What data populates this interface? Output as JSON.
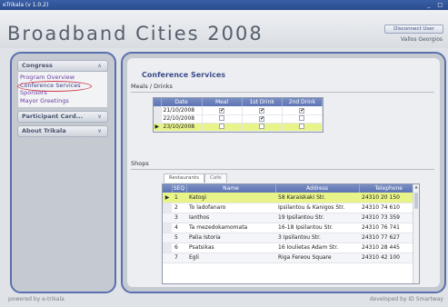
{
  "window": {
    "title": "eTrikala (v 1.0.2)",
    "controls": "_ □"
  },
  "header": {
    "brand": "Broadband Cities 2008",
    "disconnect_label": "Disconnect User",
    "username": "Vallos Georgios"
  },
  "sidebar": {
    "sections": [
      {
        "title": "Congress",
        "items": [
          "Program Overview",
          "Conference Services",
          "Sponsors",
          "Mayor Greetings"
        ]
      },
      {
        "title": "Participant Card..."
      },
      {
        "title": "About Trikala"
      }
    ]
  },
  "main": {
    "title": "Conference Services",
    "meals": {
      "group_label": "Meals / Drinks",
      "columns": [
        "Date",
        "Meal",
        "1st Drink",
        "2nd Drink"
      ],
      "rows": [
        {
          "date": "21/10/2008",
          "meal": true,
          "d1": true,
          "d2": true
        },
        {
          "date": "22/10/2008",
          "meal": false,
          "d1": true,
          "d2": false
        },
        {
          "date": "23/10/2008",
          "meal": false,
          "d1": false,
          "d2": false
        }
      ]
    },
    "shops": {
      "group_label": "Shops",
      "tabs": [
        "Restaurants",
        "Cafe"
      ],
      "columns": [
        "SEQ",
        "Name",
        "Address",
        "Telephone"
      ],
      "rows": [
        {
          "seq": "1",
          "name": "Katogi",
          "address": "58 Karaiskaki Str.",
          "phone": "24310 20 150"
        },
        {
          "seq": "2",
          "name": "To ladofanaro",
          "address": "Ipsilantou & Kanigos Str.",
          "phone": "24310 74 610"
        },
        {
          "seq": "3",
          "name": "Ianthos",
          "address": "19 Ipsilantou Str.",
          "phone": "24310 73 359"
        },
        {
          "seq": "4",
          "name": "Ta mezedokamomata",
          "address": "16-18 Ipsilantou Str.",
          "phone": "24310 76 741"
        },
        {
          "seq": "5",
          "name": "Palia Istoria",
          "address": "3 Ipsilantou Str.",
          "phone": "24310 77 627"
        },
        {
          "seq": "6",
          "name": "Psatsikas",
          "address": "16 Ioulietas Adam Str.",
          "phone": "24310 28 445"
        },
        {
          "seq": "7",
          "name": "Egli",
          "address": "Riga Fereou Square",
          "phone": "24310 42 100"
        }
      ]
    }
  },
  "footer": {
    "left": "powered by e-trikala",
    "right": "developed by ID Smartway"
  },
  "colors": {
    "accent": "#5a6fae",
    "selected_row": "#e8f48a",
    "link": "#6a3fa0",
    "highlight_circle": "#d0394d"
  }
}
